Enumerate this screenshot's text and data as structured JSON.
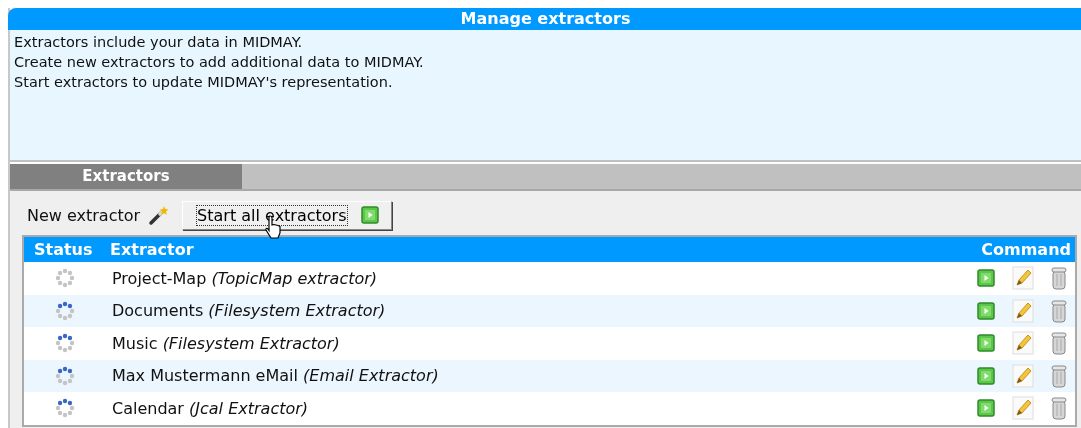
{
  "panel": {
    "title": "Manage extractors",
    "description": [
      "Extractors include your data in MIDMAY.",
      "Create new extractors to add additional data to MIDMAY.",
      "Start extractors to update MIDMAY's representation."
    ]
  },
  "tabs": [
    {
      "label": "Extractors",
      "selected": true
    }
  ],
  "toolbar": {
    "new_label": "New extractor",
    "start_all_label": "Start all extractors"
  },
  "table": {
    "columns": [
      "Status",
      "Extractor",
      "Command"
    ],
    "rows": [
      {
        "running": false,
        "name": "Project-Map",
        "type": "(TopicMap extractor)"
      },
      {
        "running": true,
        "name": "Documents",
        "type": "(Filesystem Extractor)"
      },
      {
        "running": true,
        "name": "Music",
        "type": "(Filesystem Extractor)"
      },
      {
        "running": true,
        "name": "Max Mustermann eMail",
        "type": "(Email Extractor)"
      },
      {
        "running": true,
        "name": "Calendar",
        "type": "(Jcal Extractor)"
      }
    ]
  }
}
